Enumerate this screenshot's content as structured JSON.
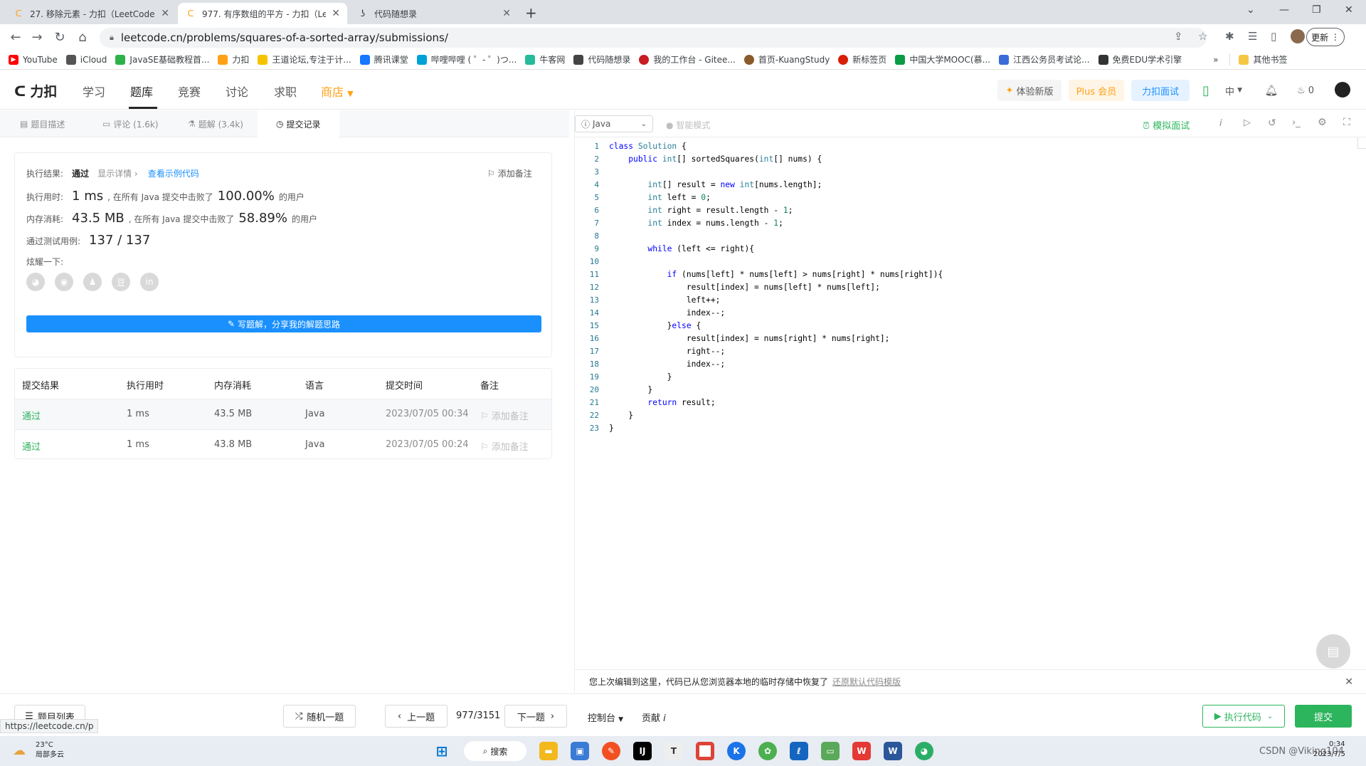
{
  "browser": {
    "tabs": [
      {
        "title": "27. 移除元素 - 力扣（LeetCode",
        "icon": "leetcode-icon",
        "active": false
      },
      {
        "title": "977. 有序数组的平方 - 力扣（Le",
        "icon": "leetcode-icon",
        "active": true
      },
      {
        "title": "代码随想录",
        "icon": "codesuixiang-icon",
        "active": false
      }
    ],
    "url": "leetcode.cn/problems/squares-of-a-sorted-array/submissions/",
    "update_label": "更新",
    "bookmarks": [
      {
        "label": "YouTube",
        "color": "#ff0000"
      },
      {
        "label": "iCloud",
        "color": "#555555"
      },
      {
        "label": "JavaSE基础教程首...",
        "color": "#2db24a"
      },
      {
        "label": "力扣",
        "color": "#ffa116"
      },
      {
        "label": "王道论坛,专注于计...",
        "color": "#f5c400"
      },
      {
        "label": "腾讯课堂",
        "color": "#1677ff"
      },
      {
        "label": "哔哩哔哩 ( ゜- ゜)つ...",
        "color": "#00a1d6"
      },
      {
        "label": "牛客网",
        "color": "#25bb9b"
      },
      {
        "label": "代码随想录",
        "color": "#444444"
      },
      {
        "label": "我的工作台 - Gitee...",
        "color": "#c71d23"
      },
      {
        "label": "首页-KuangStudy",
        "color": "#8b5a2b"
      },
      {
        "label": "新标签页",
        "color": "#d81e06"
      },
      {
        "label": "中国大学MOOC(慕...",
        "color": "#0a9b44"
      },
      {
        "label": "江西公务员考试论...",
        "color": "#3a6bd8"
      },
      {
        "label": "免费EDU学术引擎",
        "color": "#333333"
      }
    ],
    "more_bookmarks": "»",
    "other_bookmarks": "其他书签"
  },
  "nav": {
    "logo": "力扣",
    "links": [
      "学习",
      "题库",
      "竞赛",
      "讨论",
      "求职",
      "商店"
    ],
    "try_new": "体验新版",
    "plus": "Plus 会员",
    "interview": "力扣面试",
    "lang": "中",
    "streak": "0"
  },
  "left_tabs": {
    "description": "题目描述",
    "comments": "评论 (1.6k)",
    "solutions": "题解 (3.4k)",
    "submissions": "提交记录"
  },
  "result": {
    "label_result": "执行结果:",
    "status": "通过",
    "show_details": "显示详情 ›",
    "view_sample": "查看示例代码",
    "add_note": "添加备注",
    "label_time": "执行用时:",
    "time_value": "1 ms",
    "time_beat_text": ", 在所有 Java 提交中击败了",
    "time_percent": "100.00%",
    "users_suffix": "的用户",
    "label_memory": "内存消耗:",
    "memory_value": "43.5 MB",
    "memory_beat_text": ", 在所有 Java 提交中击败了",
    "memory_percent": "58.89%",
    "label_tests": "通过测试用例:",
    "tests_value": "137 / 137",
    "label_share": "炫耀一下:",
    "share_icons": [
      "wechat-icon",
      "weibo-icon",
      "qq-icon",
      "douban-icon",
      "linkedin-icon"
    ],
    "write_solution": "写题解，分享我的解题思路"
  },
  "submissions": {
    "headers": [
      "提交结果",
      "执行用时",
      "内存消耗",
      "语言",
      "提交时间",
      "备注"
    ],
    "rows": [
      {
        "status": "通过",
        "time": "1 ms",
        "memory": "43.5 MB",
        "lang": "Java",
        "submitted": "2023/07/05 00:34",
        "note": "添加备注"
      },
      {
        "status": "通过",
        "time": "1 ms",
        "memory": "43.8 MB",
        "lang": "Java",
        "submitted": "2023/07/05 00:24",
        "note": "添加备注"
      }
    ]
  },
  "editor": {
    "language": "Java",
    "smart_mode": "智能模式",
    "mock_interview": "模拟面试",
    "code_lines": [
      "class Solution {",
      "    public int[] sortedSquares(int[] nums) {",
      "",
      "        int[] result = new int[nums.length];",
      "        int left = 0;",
      "        int right = result.length - 1;",
      "        int index = nums.length - 1;",
      "",
      "        while (left <= right){",
      "",
      "            if (nums[left] * nums[left] > nums[right] * nums[right]){",
      "                result[index] = nums[left] * nums[left];",
      "                left++;",
      "                index--;",
      "            }else {",
      "                result[index] = nums[right] * nums[right];",
      "                right--;",
      "                index--;",
      "            }",
      "        }",
      "        return result;",
      "    }",
      "}"
    ],
    "notice": "您上次编辑到这里，代码已从您浏览器本地的临时存储中恢复了",
    "restore_default": "还原默认代码模版"
  },
  "bottom": {
    "problem_list": "题目列表",
    "random": "随机一题",
    "prev": "上一题",
    "progress": "977/3151",
    "next": "下一题",
    "console": "控制台",
    "contribute": "贡献",
    "run": "执行代码",
    "submit": "提交"
  },
  "status_url": "https://leetcode.cn/p",
  "taskbar": {
    "temperature": "23°C",
    "weather": "局部多云",
    "search": "搜索",
    "time": "0:34",
    "date": "2023/7/5",
    "watermark": "CSDN @Viking104"
  }
}
